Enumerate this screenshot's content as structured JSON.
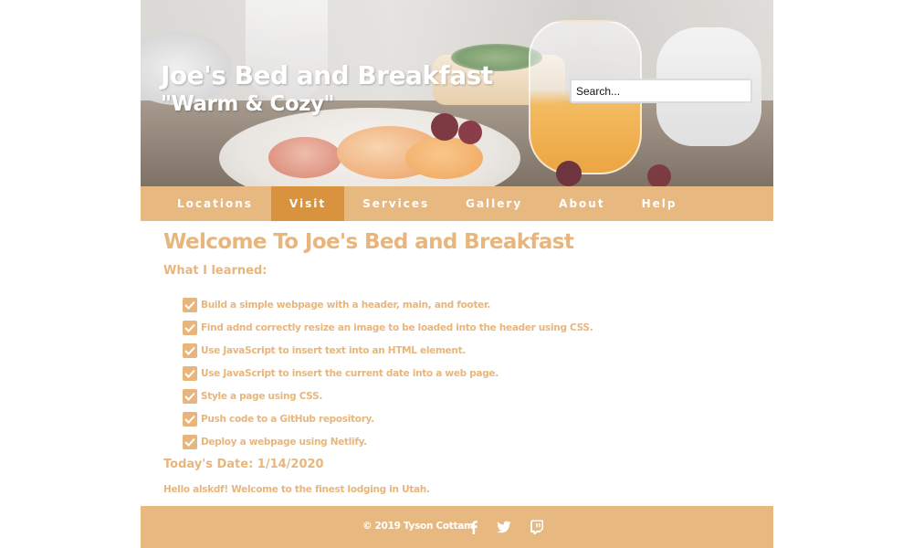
{
  "header": {
    "title": "Joe's Bed and Breakfast",
    "tagline": "\"Warm & Cozy\"",
    "search": {
      "placeholder": "Search..."
    }
  },
  "nav": {
    "items": [
      {
        "label": "Locations"
      },
      {
        "label": "Visit",
        "active": true
      },
      {
        "label": "Services"
      },
      {
        "label": "Gallery"
      },
      {
        "label": "About"
      },
      {
        "label": "Help"
      }
    ]
  },
  "main": {
    "title": "Welcome To Joe's Bed and Breakfast",
    "learned_heading": "What I learned:",
    "items": [
      "Build a simple webpage with a header, main, and footer.",
      "Find adnd correctly resize an image to be loaded into the header using CSS.",
      "Use JavaScript to insert text into an HTML element.",
      "Use JavaScript to insert the current date into a web page.",
      "Style a page using CSS.",
      "Push code to a GitHub repository.",
      "Deploy a webpage using Netlify."
    ],
    "date_line": "Today's Date: 1/14/2020",
    "welcome_message": "Hello alskdf! Welcome to the finest lodging in Utah."
  },
  "footer": {
    "copyright": "© 2019 Tyson Cottam",
    "social_icons": [
      "facebook-icon",
      "twitter-icon",
      "twitch-icon"
    ]
  },
  "colors": {
    "accent": "#e7b87f",
    "nav_active": "#d9923e",
    "text_accent": "#e8b67c",
    "white": "#ffffff"
  }
}
